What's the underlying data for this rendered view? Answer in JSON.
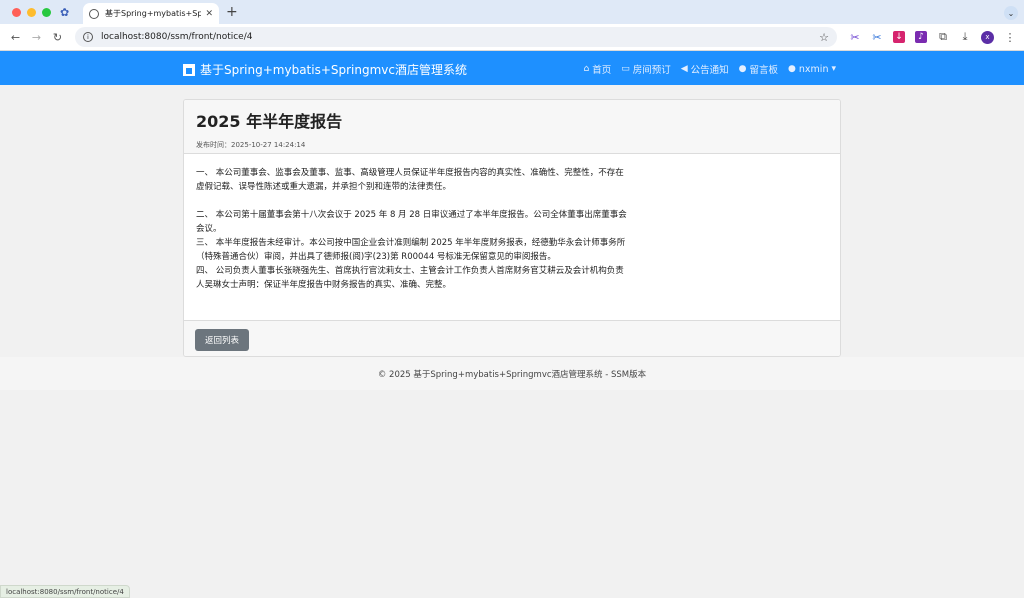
{
  "browser": {
    "tab_title": "基于Spring+mybatis+Springm",
    "tab_close": "✕",
    "new_tab": "+",
    "url": "localhost:8080/ssm/front/notice/4",
    "status_url": "localhost:8080/ssm/front/notice/4",
    "profile_initial": "x"
  },
  "site": {
    "brand": "基于Spring+mybatis+Springmvc酒店管理系统",
    "menu": [
      {
        "icon": "home-icon",
        "label": "首页"
      },
      {
        "icon": "bed-icon",
        "label": "房间预订"
      },
      {
        "icon": "megaphone-icon",
        "label": "公告通知"
      },
      {
        "icon": "comments-icon",
        "label": "留言板"
      },
      {
        "icon": "user-icon",
        "label": "nxmin"
      }
    ]
  },
  "notice": {
    "title": "2025 年半年度报告",
    "publish_label": "发布时间：",
    "publish_time": "2025-10-27 14:24:14",
    "paragraphs": [
      "一、 本公司董事会、监事会及董事、监事、高级管理人员保证半年度报告内容的真实性、准确性、完整性，不存在虚假记载、误导性陈述或重大遗漏，并承担个别和连带的法律责任。",
      "二、 本公司第十届董事会第十八次会议于 2025 年 8 月 28 日审议通过了本半年度报告。公司全体董事出席董事会会议。",
      "三、 本半年度报告未经审计。本公司按中国企业会计准则编制 2025 年半年度财务报表，经德勤华永会计师事务所（特殊普通合伙）审阅，并出具了德师报(阅)字(23)第 R00044 号标准无保留意见的审阅报告。",
      "四、 公司负责人董事长张晓强先生、首席执行官沈莉女士、主管会计工作负责人首席财务官艾耕云及会计机构负责人吴琳女士声明：保证半年度报告中财务报告的真实、准确、完整。"
    ],
    "back_button": "返回列表"
  },
  "footer": {
    "text": "© 2025 基于Spring+mybatis+Springmvc酒店管理系统 - SSM版本"
  },
  "colors": {
    "nav_bg": "#1e90ff",
    "button_bg": "#6c757d"
  }
}
